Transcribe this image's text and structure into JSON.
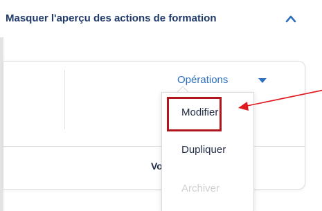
{
  "header": {
    "title": "Masquer l'aperçu des actions de formation"
  },
  "card": {
    "operations_label": "Opérations",
    "partial_text": "Vo"
  },
  "dropdown": {
    "items": [
      {
        "label": "Modifier",
        "state": "highlighted"
      },
      {
        "label": "Dupliquer",
        "state": "enabled"
      },
      {
        "label": "Archiver",
        "state": "disabled"
      }
    ]
  },
  "colors": {
    "title": "#1f3a6b",
    "link": "#2d6fbf",
    "highlight": "#b0151b",
    "arrow": "#e0191f",
    "disabled": "#d0d0d0"
  },
  "icons": [
    "chevron-up-icon",
    "caret-down-icon",
    "arrow-annotation"
  ]
}
